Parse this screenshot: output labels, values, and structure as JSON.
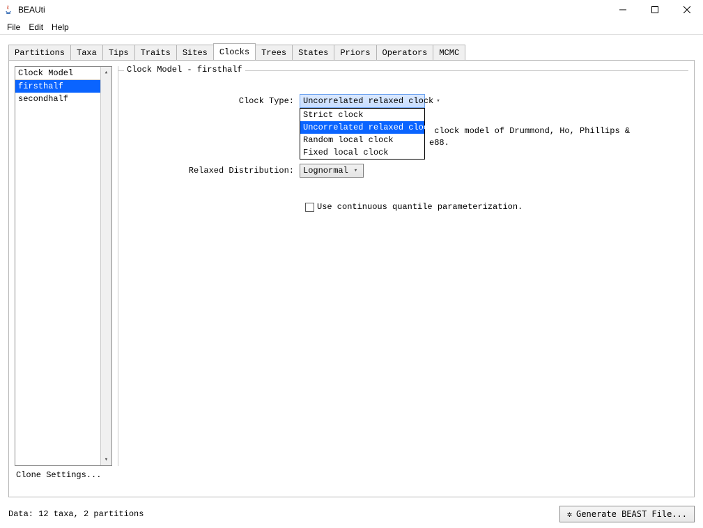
{
  "window": {
    "title": "BEAUti"
  },
  "menu": {
    "file": "File",
    "edit": "Edit",
    "help": "Help"
  },
  "tabs": {
    "partitions": "Partitions",
    "taxa": "Taxa",
    "tips": "Tips",
    "traits": "Traits",
    "sites": "Sites",
    "clocks": "Clocks",
    "trees": "Trees",
    "states": "States",
    "priors": "Priors",
    "operators": "Operators",
    "mcmc": "MCMC",
    "active": "clocks"
  },
  "clock_list": {
    "header": "Clock Model",
    "items": [
      "firsthalf",
      "secondhalf"
    ],
    "selected_index": 0,
    "clone_label": "Clone Settings..."
  },
  "fieldset": {
    "legend": "Clock Model - firsthalf"
  },
  "form": {
    "clock_type_label": "Clock Type:",
    "clock_type_value": "Uncorrelated relaxed clock",
    "clock_type_options": [
      "Strict clock",
      "Uncorrelated relaxed clock",
      "Random local clock",
      "Fixed local clock"
    ],
    "clock_type_highlight_index": 1,
    "clock_type_desc_line1": " clock model of Drummond, Ho, Phillips &",
    "clock_type_desc_line2": "e88.",
    "relaxed_dist_label": "Relaxed Distribution:",
    "relaxed_dist_value": "Lognormal",
    "continuous_quantile_label": "Use continuous quantile parameterization."
  },
  "status": {
    "text": "Data: 12 taxa, 2 partitions"
  },
  "buttons": {
    "generate": "Generate BEAST File..."
  }
}
